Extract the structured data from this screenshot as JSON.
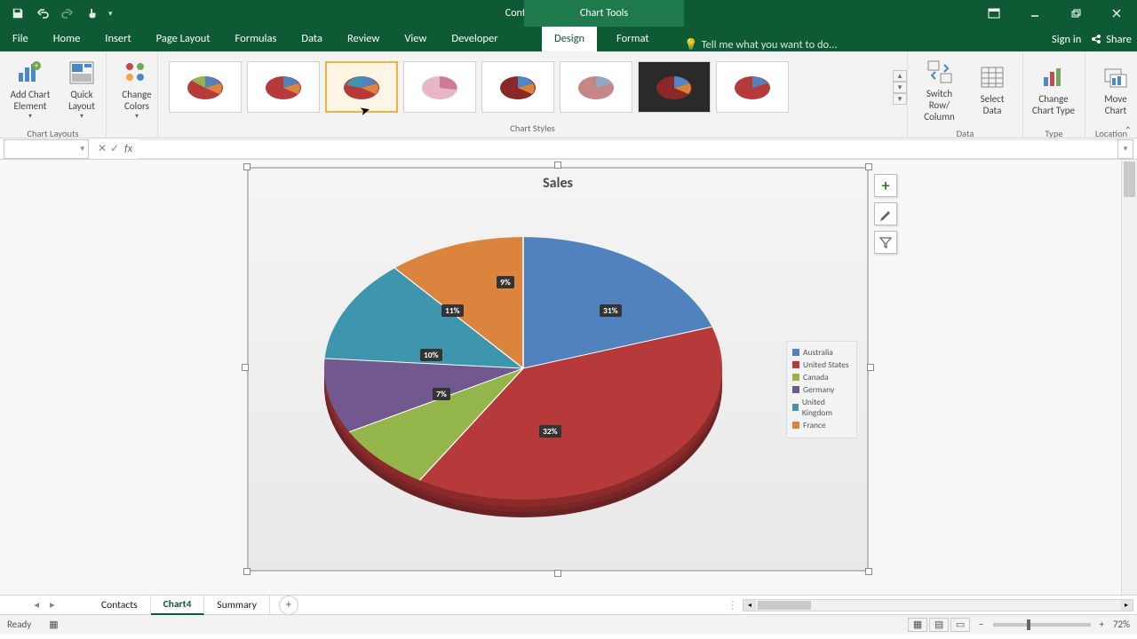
{
  "titlebar": {
    "filename": "ContactsSummary.xlsx - Excel",
    "context_title": "Chart Tools"
  },
  "tabs": {
    "file": "File",
    "home": "Home",
    "insert": "Insert",
    "pagelayout": "Page Layout",
    "formulas": "Formulas",
    "data": "Data",
    "review": "Review",
    "view": "View",
    "developer": "Developer",
    "design": "Design",
    "format": "Format",
    "tellme": "Tell me what you want to do...",
    "signin": "Sign in",
    "share": "Share"
  },
  "ribbon": {
    "chart_layouts": {
      "label": "Chart Layouts",
      "add_element": "Add Chart\nElement",
      "quick_layout": "Quick\nLayout"
    },
    "change_colors": "Change\nColors",
    "chart_styles_label": "Chart Styles",
    "data": {
      "label": "Data",
      "switch": "Switch Row/\nColumn",
      "select": "Select\nData"
    },
    "type": {
      "label": "Type",
      "change": "Change\nChart Type"
    },
    "location": {
      "label": "Location",
      "move": "Move\nChart"
    }
  },
  "chart_data": {
    "type": "pie",
    "title": "Sales",
    "series": [
      {
        "name": "Australia",
        "pct": 31,
        "color": "#5082bd"
      },
      {
        "name": "United States",
        "pct": 32,
        "color": "#b73a3b"
      },
      {
        "name": "Canada",
        "pct": 7,
        "color": "#93b54a"
      },
      {
        "name": "Germany",
        "pct": 10,
        "color": "#71588f"
      },
      {
        "name": "United Kingdom",
        "pct": 11,
        "color": "#3d96ae"
      },
      {
        "name": "France",
        "pct": 9,
        "color": "#db843d"
      }
    ],
    "data_label_suffix": "%"
  },
  "sheets": {
    "tabs": [
      "Contacts",
      "Chart4",
      "Summary"
    ],
    "active": "Chart4"
  },
  "status": {
    "ready": "Ready",
    "zoom": "72%"
  }
}
